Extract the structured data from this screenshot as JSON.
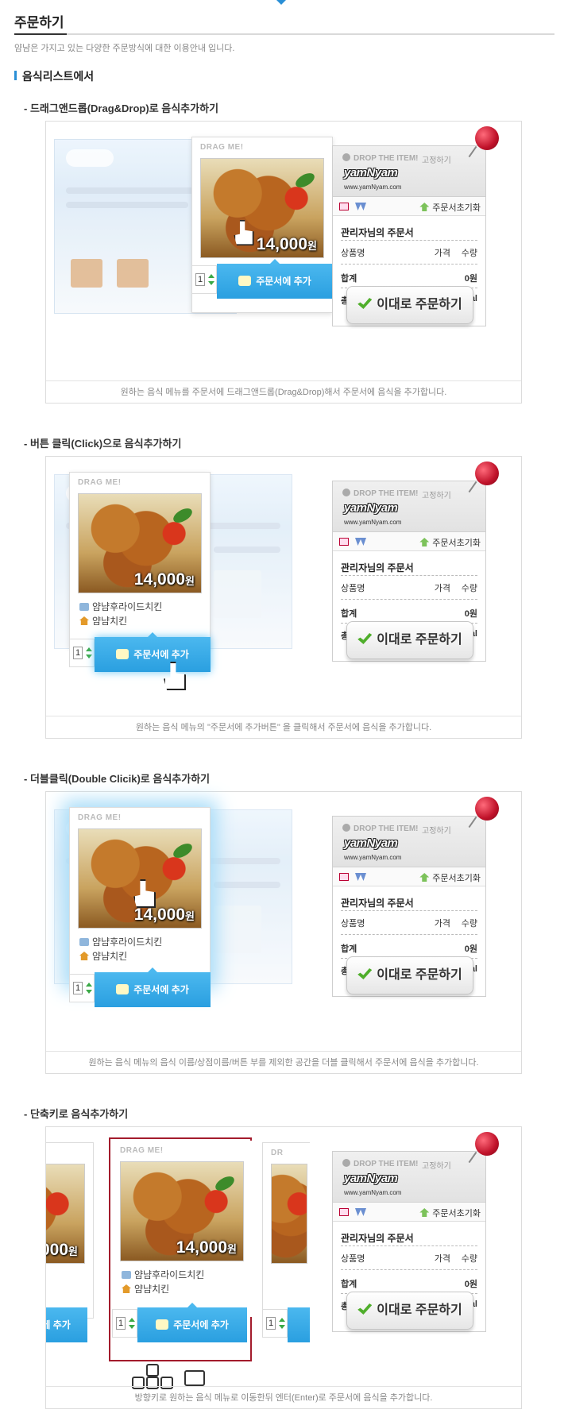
{
  "page": {
    "title": "주문하기",
    "description": "얌냠은 가지고 있는 다양한 주문방식에 대한 이용안내 입니다.",
    "section_title": "음식리스트에서"
  },
  "card": {
    "drag_label": "DRAG ME!",
    "price": "14,000",
    "currency": "원",
    "food_name": "얌냠후라이드치킨",
    "store_name": "얌냠치킨",
    "qty": "1",
    "add_button": "주문서에 추가"
  },
  "order": {
    "drop_text": "DROP THE ITEM!",
    "fixed": "고정하기",
    "logo": "yamNyam",
    "site": "www.yamNyam.com",
    "reset": "주문서초기화",
    "owner": "관리자님의 주문서",
    "product": "상품명",
    "price": "가격",
    "quantity": "수량",
    "total_label": "합계",
    "total_value": "0원",
    "calorie_label": "총열량",
    "calorie_value": "0KCal",
    "order_button": "이대로 주문하기"
  },
  "sections": [
    {
      "heading": "- 드래그앤드롭(Drag&Drop)로 음식추가하기",
      "caption": "원하는 음식 메뉴를 주문서에 드래그앤드롭(Drag&Drop)해서 주문서에 음식을 추가합니다."
    },
    {
      "heading": "- 버튼 클릭(Click)으로 음식추가하기",
      "caption": "원하는 음식 메뉴의 \"주문서에 추가버튼\" 을 클릭해서 주문서에 음식을 추가합니다."
    },
    {
      "heading": "- 더블클릭(Double Clicik)로 음식추가하기",
      "caption": "원하는 음식 메뉴의 음식 이름/상점이름/버튼 부를 제외한 공간을 더블 클릭해서 주문서에 음식을 추가합니다."
    },
    {
      "heading": "- 단축키로 음식추가하기",
      "caption": "방향키로 원하는 음식 메뉴로 이동한뒤 엔터(Enter)로 주문서에 음식을 추가합니다."
    }
  ],
  "colors": {
    "accent": "#2a9fe0",
    "pin": "#c0122a",
    "check": "#4fae2b"
  }
}
